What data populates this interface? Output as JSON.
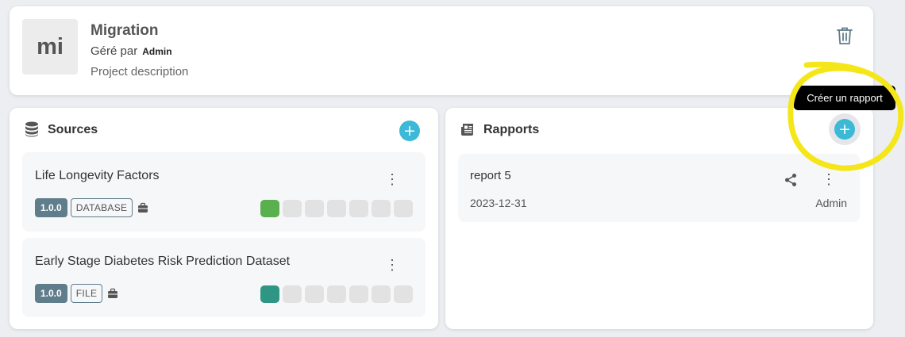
{
  "project": {
    "avatar_text": "mi",
    "title": "Migration",
    "managed_by_label": "Géré par",
    "managed_by_user": "Admin",
    "description": "Project description"
  },
  "sources": {
    "title": "Sources",
    "items": [
      {
        "name": "Life Longevity Factors",
        "version": "1.0.0",
        "type": "DATABASE",
        "status_color": "#5aaf4e",
        "blocks_total": 7,
        "blocks_filled": 1
      },
      {
        "name": "Early Stage Diabetes Risk Prediction Dataset",
        "version": "1.0.0",
        "type": "FILE",
        "status_color": "#2e9683",
        "blocks_total": 7,
        "blocks_filled": 1
      }
    ]
  },
  "reports": {
    "title": "Rapports",
    "add_tooltip": "Créer un rapport",
    "items": [
      {
        "name": "report 5",
        "date": "2023-12-31",
        "user": "Admin"
      }
    ]
  },
  "colors": {
    "accent": "#3bb9d6",
    "badge": "#607d8b",
    "highlight": "#f5e61a"
  },
  "add_symbol": "+",
  "kebab_symbol": "⋮"
}
